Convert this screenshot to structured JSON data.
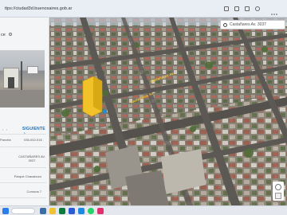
{
  "browser": {
    "url": "ttps://ciudad3d.buenosaires.gob.ar"
  },
  "sidebar": {
    "title": "ce",
    "next_label": "SIGUIENTE",
    "next_arrow": "›",
    "pager_dots": "• •",
    "rows": [
      {
        "left": "Parcela",
        "right": "036-002-016"
      },
      {
        "left": "",
        "right": "CASTAÑARES AV.\n3037"
      },
      {
        "left": "",
        "right": "Parque Chacabuco"
      },
      {
        "left": "",
        "right": "Comuna 7"
      }
    ]
  },
  "map": {
    "search_value": "Castañares Av. 3037",
    "street_labels": [
      "Castañares Av.",
      "Castañares Av."
    ]
  },
  "colors": {
    "building_highlight": "#f2c22a",
    "pin": "#1f8fd6"
  }
}
